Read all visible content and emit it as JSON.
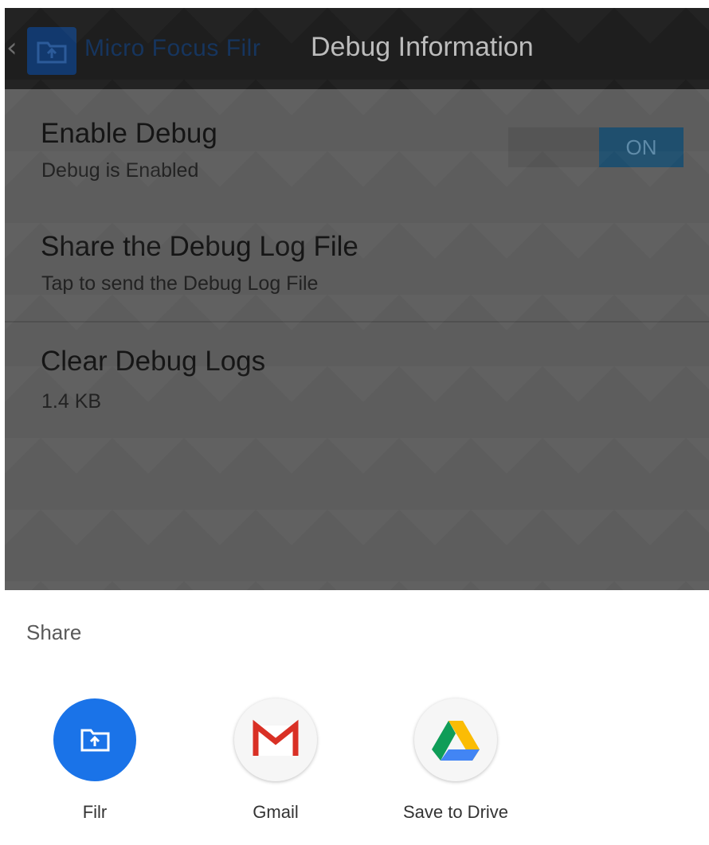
{
  "header": {
    "app_name": "Micro Focus Filr",
    "title": "Debug Information"
  },
  "settings": {
    "enable_debug": {
      "title": "Enable Debug",
      "subtitle": "Debug is Enabled",
      "toggle_label": "ON"
    },
    "share_log": {
      "title": "Share the Debug Log File",
      "subtitle": "Tap to send the Debug Log File"
    },
    "clear_logs": {
      "title": "Clear Debug Logs",
      "subtitle": "1.4 KB"
    }
  },
  "share_sheet": {
    "title": "Share",
    "targets": [
      {
        "label": "Filr",
        "icon": "filr-icon",
        "color": "#1a73e8"
      },
      {
        "label": "Gmail",
        "icon": "gmail-icon",
        "color": "#d93025"
      },
      {
        "label": "Save to Drive",
        "icon": "drive-icon",
        "color": "#0f9d58"
      }
    ]
  },
  "colors": {
    "overlay_background": "#5d5d5d",
    "topbar": "#1e1e1e",
    "toggle_on": "#1f4f6e"
  }
}
